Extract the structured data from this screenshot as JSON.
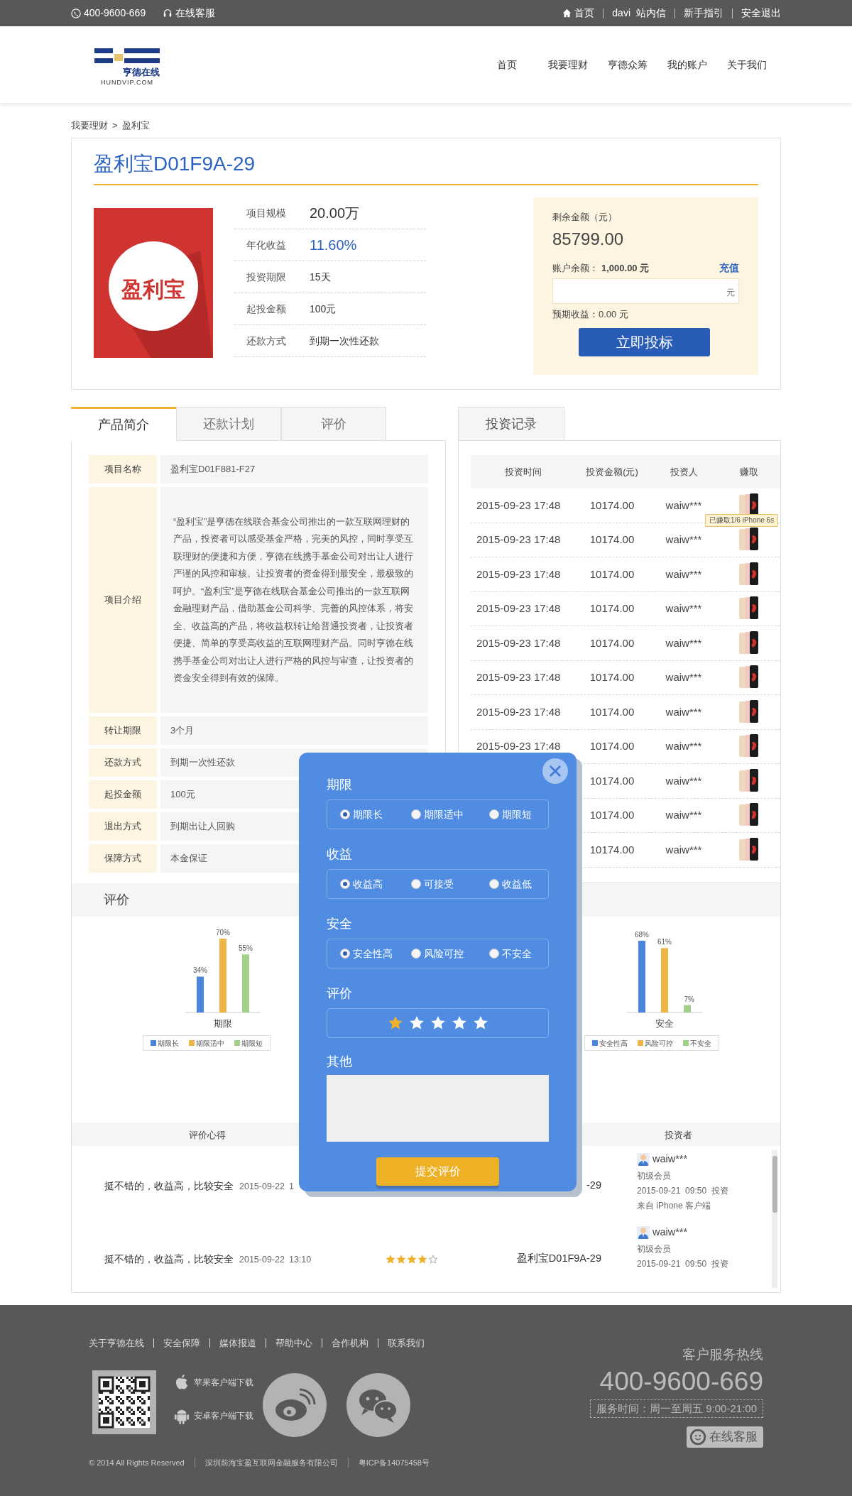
{
  "top_bar": {
    "phone": "400-9600-669",
    "service": "在线客服",
    "links": [
      {
        "label": "首页",
        "kind": "home"
      },
      {
        "label": "davi",
        "kind": "user"
      },
      {
        "label": "站内信",
        "kind": "link"
      },
      {
        "label": "新手指引",
        "kind": "link"
      },
      {
        "label": "安全退出",
        "kind": "link"
      }
    ]
  },
  "header": {
    "logo_text": "亨德在线",
    "logo_subtext": "HUNDVIP.COM",
    "nav": [
      "首页",
      "我要理财",
      "亨德众筹",
      "我的账户",
      "关于我们"
    ]
  },
  "breadcrumb": {
    "items": [
      "我要理财",
      "盈利宝"
    ],
    "separator": ">"
  },
  "product": {
    "title": "盈利宝D01F9A-29",
    "cover_text": "盈利宝",
    "facts": [
      {
        "label": "项目规模",
        "value": "20.00万",
        "kind": "large"
      },
      {
        "label": "年化收益",
        "value": "11.60%",
        "kind": "highlight"
      },
      {
        "label": "投资期限",
        "value": "15天",
        "kind": "plain"
      },
      {
        "label": "起投金额",
        "value": "100元",
        "kind": "plain"
      },
      {
        "label": "还款方式",
        "value": "到期一次性还款",
        "kind": "plain"
      }
    ],
    "invest": {
      "remaining_label": "剩余金额（元）",
      "remaining": "85799.00",
      "balance_label": "账户余额：",
      "balance": "1,000.00 元",
      "recharge": "充值",
      "amount_unit": "元",
      "expected": "预期收益：0.00 元",
      "submit": "立即投标"
    }
  },
  "detail_tabs": [
    {
      "label": "产品简介",
      "selected": true
    },
    {
      "label": "还款计划",
      "selected": false
    },
    {
      "label": "评价",
      "selected": false
    }
  ],
  "details": [
    {
      "label": "项目名称",
      "value": "盈利宝D01F881-F27"
    },
    {
      "label": "项目介绍",
      "value": "“盈利宝”是亨德在线联合基金公司推出的一款互联网理财的产品，投资者可以感受基金严格，完美的风控，同时享受互联理财的便捷和方便，亨德在线携手基金公司对出让人进行严谨的风控和审核。让投资者的资金得到最安全，最极致的呵护。“盈利宝”是亨德在线联合基金公司推出的一款互联网金融理财产品，借助基金公司科学、完善的风控体系，将安全、收益高的产品，将收益权转让给普通投资者，让投资者便捷、简单的享受高收益的互联网理财产品。同时亨德在线携手基金公司对出让人进行严格的风控与审查，让投资者的资金安全得到有效的保障。"
    },
    {
      "label": "转让期限",
      "value": "3个月"
    },
    {
      "label": "还款方式",
      "value": "到期一次性还款"
    },
    {
      "label": "起投金额",
      "value": "100元"
    },
    {
      "label": "退出方式",
      "value": "到期出让人回购"
    },
    {
      "label": "保障方式",
      "value": "本金保证"
    }
  ],
  "records": {
    "tab": "投资记录",
    "columns": [
      "投资时间",
      "投资金额(元)",
      "投资人",
      "赚取"
    ],
    "rows": [
      {
        "time": "2015-09-23 17:48",
        "amount": "10174.00",
        "investor": "waiw***"
      },
      {
        "time": "2015-09-23 17:48",
        "amount": "10174.00",
        "investor": "waiw***"
      },
      {
        "time": "2015-09-23 17:48",
        "amount": "10174.00",
        "investor": "waiw***"
      },
      {
        "time": "2015-09-23 17:48",
        "amount": "10174.00",
        "investor": "waiw***"
      },
      {
        "time": "2015-09-23 17:48",
        "amount": "10174.00",
        "investor": "waiw***"
      },
      {
        "time": "2015-09-23 17:48",
        "amount": "10174.00",
        "investor": "waiw***"
      },
      {
        "time": "2015-09-23 17:48",
        "amount": "10174.00",
        "investor": "waiw***"
      },
      {
        "time": "2015-09-23 17:48",
        "amount": "10174.00",
        "investor": "waiw***"
      },
      {
        "amount": "10174.00",
        "investor": "waiw***"
      },
      {
        "amount": "10174.00",
        "investor": "waiw***"
      },
      {
        "amount": "10174.00",
        "investor": "waiw***"
      }
    ],
    "tooltip": "已赚取1/6 iPhone 6s"
  },
  "review_section": {
    "title": "评价",
    "charts": [
      {
        "label_suffix": "%",
        "chart_data": {
          "type": "bar",
          "categories": [
            "期限"
          ],
          "data_labels": true,
          "legend": "bottom",
          "series": [
            {
              "name": "期限长",
              "color": "#4a86e0",
              "values": [
                34
              ]
            },
            {
              "name": "期限适中",
              "color": "#eeb445",
              "values": [
                70
              ]
            },
            {
              "name": "期限短",
              "color": "#a3d18a",
              "values": [
                55
              ]
            }
          ]
        }
      },
      {
        "label_suffix": "%",
        "chart_data": {
          "type": "bar",
          "categories": [
            "安全"
          ],
          "data_labels": true,
          "legend": "bottom",
          "series": [
            {
              "name": "安全性高",
              "color": "#4a86e0",
              "values": [
                68
              ]
            },
            {
              "name": "风险可控",
              "color": "#eeb445",
              "values": [
                61
              ]
            },
            {
              "name": "不安全",
              "color": "#a3d18a",
              "values": [
                7
              ]
            }
          ]
        }
      }
    ]
  },
  "reviews": {
    "columns": [
      "评价心得",
      "投资者"
    ],
    "rows": [
      {
        "comment": "挺不错的，收益高，比较安全",
        "date": "2015-09-22",
        "time": "1",
        "product": "-29",
        "investor": "waiw***",
        "level": "初级会员",
        "invest_time": "2015-09-21  09:50  投资",
        "source": "来自 iPhone 客户端"
      },
      {
        "comment": "挺不错的，收益高，比较安全",
        "date": "2015-09-22",
        "time": "13:10",
        "stars": 4,
        "product": "盈利宝D01F9A-29",
        "investor": "waiw***",
        "level": "初级会员",
        "invest_time": "2015-09-21  09:50  投资"
      }
    ]
  },
  "modal": {
    "groups": [
      {
        "title": "期限",
        "options": [
          {
            "label": "期限长",
            "selected": true
          },
          {
            "label": "期限适中",
            "selected": false
          },
          {
            "label": "期限短",
            "selected": false
          }
        ]
      },
      {
        "title": "收益",
        "options": [
          {
            "label": "收益高",
            "selected": true
          },
          {
            "label": "可接受",
            "selected": false
          },
          {
            "label": "收益低",
            "selected": false
          }
        ]
      },
      {
        "title": "安全",
        "options": [
          {
            "label": "安全性高",
            "selected": true
          },
          {
            "label": "风险可控",
            "selected": false
          },
          {
            "label": "不安全",
            "selected": false
          }
        ]
      }
    ],
    "rating": {
      "title": "评价",
      "stars": 1
    },
    "other": {
      "title": "其他"
    },
    "submit": "提交评价"
  },
  "footer": {
    "links": [
      "关于亨德在线",
      "安全保障",
      "媒体报道",
      "帮助中心",
      "合作机构",
      "联系我们"
    ],
    "apps": [
      {
        "label": "苹果客户端下载",
        "kind": "apple"
      },
      {
        "label": "安卓客户端下载",
        "kind": "android"
      }
    ],
    "hotline_title": "客户服务热线",
    "hotline": "400-9600-669",
    "hours": "服务时间：周一至周五 9:00-21:00",
    "online_service": "在线客服",
    "bottom": [
      "© 2014  All Rights Reserved",
      "深圳前海宝盈互联网金融服务有限公司",
      "粤ICP备14075458号"
    ]
  }
}
